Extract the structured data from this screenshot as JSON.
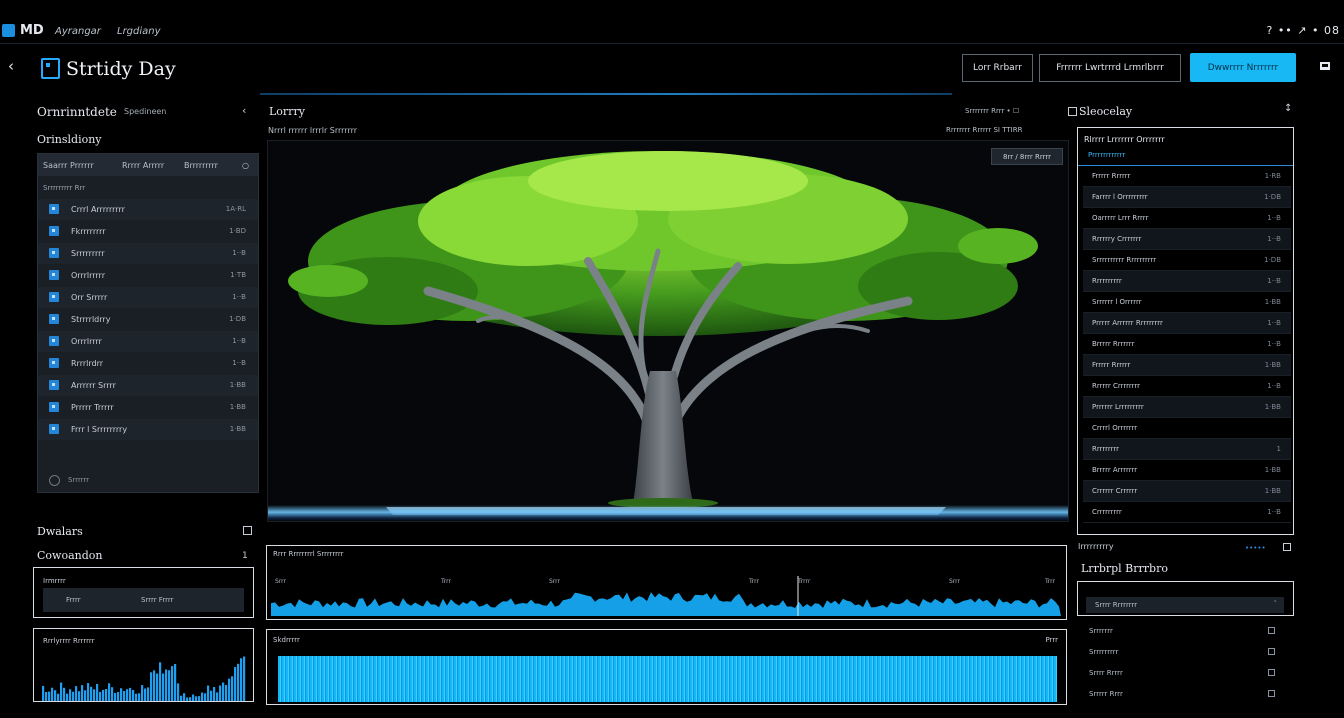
{
  "topbar": {
    "app_title": "MD",
    "menu": [
      "Ayrangar",
      "Lrgdiany"
    ],
    "tray": "? •• ↗ • 08"
  },
  "header": {
    "title": "Strtidy Day",
    "buttons": [
      "Lorr Rrbarr",
      "Frrrrrr Lwrtrrrd Lrmrlbrrr"
    ],
    "primary_button": "Dwwrrrr Nrrrrrrr",
    "accent": "#18b8f5"
  },
  "left": {
    "title": "Ornrinntdete",
    "subtitle": "Spedineen",
    "section": "Orinsldiony",
    "tabs": [
      "Saarrr Prrrrrr",
      "Rrrrr Arrrrr",
      "Brrrrrrrrr"
    ],
    "group_label": "Srrrrrrrrr Rrr",
    "items": [
      {
        "label": "Crrrl Arrrrrrrrr",
        "value": "1A·RL"
      },
      {
        "label": "Fkrrrrrrrr",
        "value": "1·BD"
      },
      {
        "label": "Srrrrrrrrr",
        "value": "1··B"
      },
      {
        "label": "Orrrlrrrrr",
        "value": "1·TB"
      },
      {
        "label": "Orr Srrrrr",
        "value": "1··B"
      },
      {
        "label": "Strrrrldrry",
        "value": "1·DB"
      },
      {
        "label": "Orrrlrrrr",
        "value": "1··B"
      },
      {
        "label": "Rrrrlrdrr",
        "value": "1··B"
      },
      {
        "label": "Arrrrrr Srrrr",
        "value": "1·BB"
      },
      {
        "label": "Prrrrr Trrrrr",
        "value": "1·BB"
      },
      {
        "label": "Frrr l Srrrrrrrry",
        "value": "1·BB"
      }
    ],
    "list_footer": "Srrrrrr",
    "devices_title": "Dwalars",
    "comp_title": "Cowoandon",
    "comp_count": "1",
    "comp_card_label": "Irmrrrr",
    "comp_field": [
      "Frrrr",
      "Srrrr Frrrr"
    ],
    "mini_label": "Rrrlyrrrr Rrrrrrr"
  },
  "center": {
    "title": "Lorrry",
    "subtitle": "Nrrrl rrrrrr lrrrlr Srrrrrrr",
    "tools": "Srrrrrrr   Rrrr   •   ☐",
    "meta": "Rrrrrrrr Rrrrrr   SI TTIRR",
    "viewport_badge": "8rr / 8rrr Rrrrr",
    "wave_title": "Rrrr Rrrrrrrrl Srrrrrrrr",
    "wave_ticks": [
      "Srrr",
      "Trrr",
      "Srrr",
      "Trrr",
      "Trrrr",
      "Srrr",
      "Trrr"
    ],
    "signal_title": "Skdrrrrr",
    "signal_right": "Prrr",
    "accent": "#17b6f6"
  },
  "right": {
    "title": "Sleocelay",
    "table_header": "Rlrrrr Lrrrrrrr Orrrrrrr",
    "table_sub": "Prrrrrrrrrrrr",
    "rows": [
      {
        "label": "Frrrrr Rrrrrr",
        "value": "1·RB"
      },
      {
        "label": "Farrrr l Orrrrrrrrr",
        "value": "1·DB"
      },
      {
        "label": "Oarrrrr Lrrr Rrrrr",
        "value": "1··B"
      },
      {
        "label": "Rrrrrry Crrrrrrr",
        "value": "1··B"
      },
      {
        "label": "Srrrrrrrrrr Rrrrrrrrrr",
        "value": "1·DB"
      },
      {
        "label": "Rrrrrrrrrr",
        "value": "1··B"
      },
      {
        "label": "Srrrrrr l Orrrrrr",
        "value": "1·BB"
      },
      {
        "label": "Prrrrr Arrrrrr Rrrrrrrrr",
        "value": "1··B"
      },
      {
        "label": "Brrrrr Rrrrrrr",
        "value": "1··B"
      },
      {
        "label": "Frrrrr Rrrrrr",
        "value": "1·BB"
      },
      {
        "label": "Rrrrrr Crrrrrrrr",
        "value": "1··B"
      },
      {
        "label": "Prrrrrr Lrrrrrrrrr",
        "value": "1·BB"
      },
      {
        "label": "Crrrrl Orrrrrrr",
        "value": ""
      },
      {
        "label": "Rrrrrrrrr",
        "value": "1"
      },
      {
        "label": "Brrrrr Arrrrrrr",
        "value": "1·BB"
      },
      {
        "label": "Crrrrrr Crrrrrr",
        "value": "1·BB"
      },
      {
        "label": "Crrrrrrrrr",
        "value": "1··B"
      }
    ],
    "section": "Irrrrrrrrry",
    "section_link": "•••••",
    "section2": "Lrrbrpl Brrrbro",
    "card_field": "Srrrr Rrrrrrrr",
    "list": [
      "Srrrrrrr",
      "Srrrrrrrrr",
      "Srrrr Rrrrr",
      "Srrrrr Rrrr"
    ]
  }
}
